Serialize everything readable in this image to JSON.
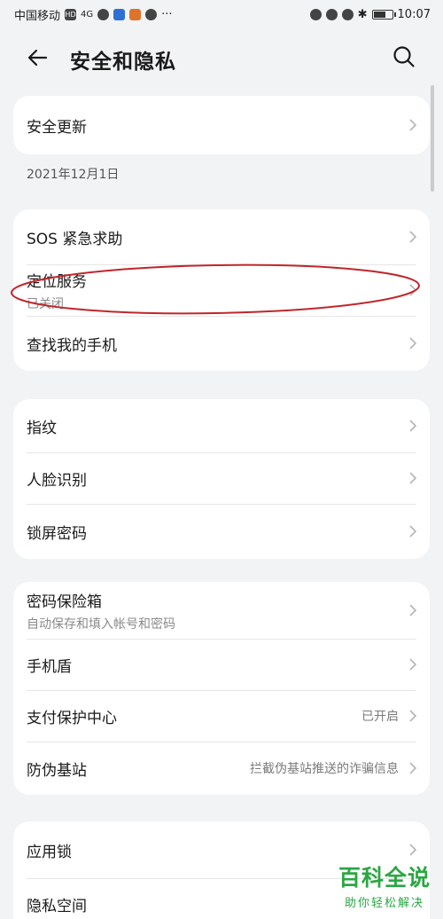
{
  "status_bar": {
    "carrier": "中国移动",
    "network": "HD",
    "signal": "4G",
    "time": "10:07"
  },
  "header": {
    "title": "安全和隐私"
  },
  "security_update": {
    "label": "安全更新",
    "date": "2021年12月1日"
  },
  "group_location": [
    {
      "label": "SOS 紧急求助"
    },
    {
      "label": "定位服务",
      "sub": "已关闭"
    },
    {
      "label": "查找我的手机"
    }
  ],
  "group_unlock": [
    {
      "label": "指纹"
    },
    {
      "label": "人脸识别"
    },
    {
      "label": "锁屏密码"
    }
  ],
  "group_protection": [
    {
      "label": "密码保险箱",
      "sub": "自动保存和填入帐号和密码"
    },
    {
      "label": "手机盾"
    },
    {
      "label": "支付保护中心",
      "value": "已开启"
    },
    {
      "label": "防伪基站",
      "value": "拦截伪基站推送的诈骗信息"
    }
  ],
  "group_apps": [
    {
      "label": "应用锁"
    },
    {
      "label": "隐私空间"
    }
  ],
  "watermark": {
    "main": "百科全说",
    "sub": "助你轻松解决"
  },
  "colors": {
    "background": "#f1f3f5",
    "card": "#ffffff",
    "highlight": "#c0262a",
    "watermark": "#2aa743"
  }
}
